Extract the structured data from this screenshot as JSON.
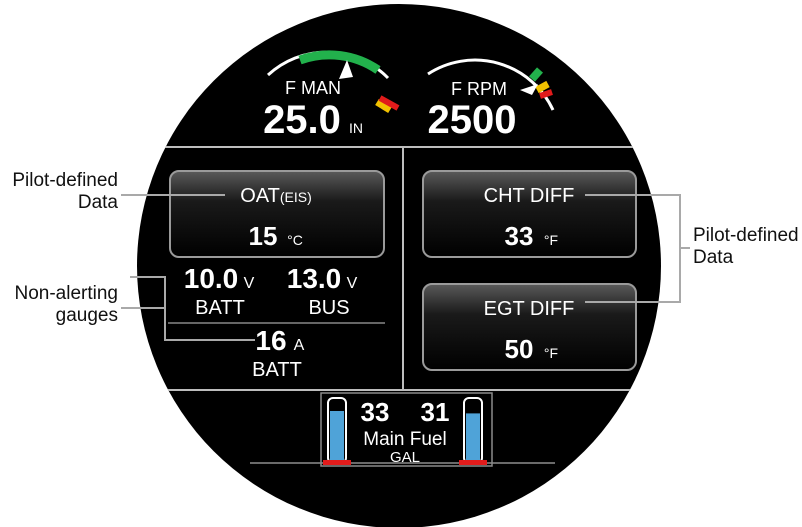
{
  "gauges": {
    "manifold": {
      "label": "F MAN",
      "value": "25.0",
      "unit": "IN"
    },
    "rpm": {
      "label": "F RPM",
      "value": "2500"
    }
  },
  "left_panel": {
    "box": {
      "title": "OAT",
      "title_sub": "(EIS)",
      "value": "15",
      "unit": "°C"
    },
    "batt_volts": {
      "value": "10.0",
      "unit": "V",
      "label": "BATT"
    },
    "bus_volts": {
      "value": "13.0",
      "unit": "V",
      "label": "BUS"
    },
    "batt_amps": {
      "value": "16",
      "unit": "A",
      "label": "BATT"
    }
  },
  "right_panel": {
    "box1": {
      "title": "CHT DIFF",
      "value": "33",
      "unit": "°F"
    },
    "box2": {
      "title": "EGT DIFF",
      "value": "50",
      "unit": "°F"
    }
  },
  "fuel": {
    "left_value": "33",
    "right_value": "31",
    "label": "Main Fuel",
    "unit": "GAL",
    "left_level": 0.82,
    "right_level": 0.78
  },
  "callouts": {
    "left_top": [
      "Pilot-defined",
      "Data"
    ],
    "left_bottom": [
      "Non-alerting",
      "gauges"
    ],
    "right": [
      "Pilot-defined",
      "Data"
    ]
  },
  "colors": {
    "display_bg": "#000000",
    "text": "#ffffff",
    "green": "#22b14c",
    "red": "#e11b1b",
    "yellow": "#f2c200",
    "fuel_fill": "#4fa3d8",
    "box_border": "#9a9a9a"
  }
}
